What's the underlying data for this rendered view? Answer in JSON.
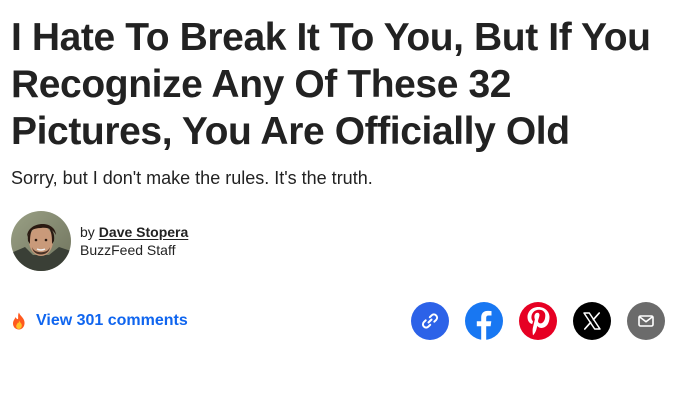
{
  "article": {
    "headline": "I Hate To Break It To You, But If You Recognize Any Of These 32 Pictures, You Are Officially Old",
    "subhead": "Sorry, but I don't make the rules. It's the truth."
  },
  "byline": {
    "prefix": "by",
    "author_name": "Dave Stopera",
    "author_role": "BuzzFeed Staff"
  },
  "comments": {
    "icon": "fire-icon",
    "label": "View 301 comments"
  },
  "share": {
    "buttons": [
      {
        "name": "copy-link",
        "icon": "link-icon",
        "color": "#2c62e8"
      },
      {
        "name": "facebook",
        "icon": "facebook-icon",
        "color": "#1877f2"
      },
      {
        "name": "pinterest",
        "icon": "pinterest-icon",
        "color": "#e60023"
      },
      {
        "name": "x",
        "icon": "x-icon",
        "color": "#000000"
      },
      {
        "name": "email",
        "icon": "envelope-icon",
        "color": "#6b6b6b"
      }
    ]
  },
  "colors": {
    "text": "#222222",
    "accent_link": "#0f65ef"
  }
}
